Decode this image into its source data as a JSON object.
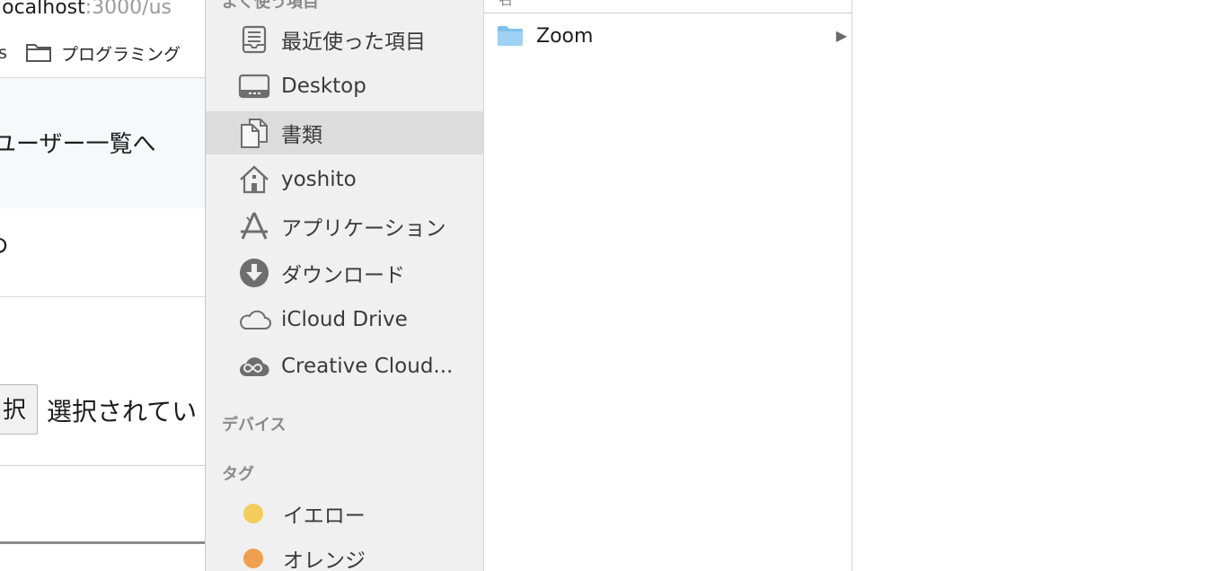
{
  "browser": {
    "address_host": "localhost",
    "address_path": ":3000/us",
    "bookmark_fragment": "s",
    "bookmark_folder": "プログラミング",
    "link_text": "ユーザー一覧へ",
    "page_text": "ゆ",
    "file_button": "択",
    "file_status": "選択されてい"
  },
  "sidebar": {
    "favorites_header": "よく使う項目",
    "items": [
      {
        "label": "最近使った項目",
        "icon": "recents-icon"
      },
      {
        "label": "Desktop",
        "icon": "desktop-icon"
      },
      {
        "label": "書類",
        "icon": "documents-icon",
        "selected": true
      },
      {
        "label": "yoshito",
        "icon": "home-icon"
      },
      {
        "label": "アプリケーション",
        "icon": "applications-icon"
      },
      {
        "label": "ダウンロード",
        "icon": "downloads-icon"
      },
      {
        "label": "iCloud Drive",
        "icon": "icloud-icon"
      },
      {
        "label": "Creative Cloud...",
        "icon": "creative-cloud-icon"
      }
    ],
    "devices_header": "デバイス",
    "tags_header": "タグ",
    "tags": [
      {
        "label": "イエロー",
        "color": "#f2cd5c"
      },
      {
        "label": "オレンジ",
        "color": "#efa04f"
      }
    ]
  },
  "column": {
    "header_fragment": "名",
    "rows": [
      {
        "name": "Zoom",
        "icon": "folder-icon",
        "has_children": true
      }
    ]
  }
}
